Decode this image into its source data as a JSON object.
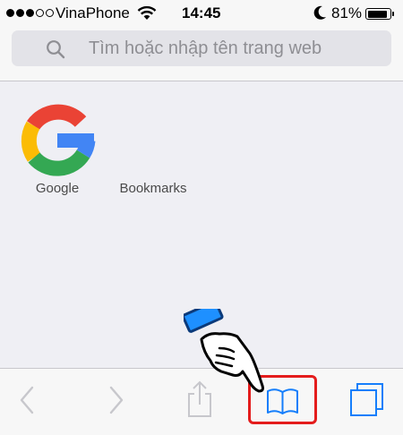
{
  "status_bar": {
    "carrier": "VinaPhone",
    "time": "14:45",
    "battery_percent": "81%",
    "signal_bars_filled": 3,
    "signal_bars_total": 5
  },
  "search": {
    "placeholder": "Tìm hoặc nhập tên trang web"
  },
  "favorites": [
    {
      "label": "Google",
      "icon": "google-logo"
    },
    {
      "label": "Bookmarks",
      "icon": "bookmarks-folder"
    }
  ],
  "toolbar": {
    "items": [
      "back-icon",
      "forward-icon",
      "share-icon",
      "bookmarks-icon",
      "tabs-icon"
    ],
    "highlighted": "bookmarks-icon"
  },
  "colors": {
    "accent": "#157efb",
    "highlight": "#e41c1c",
    "disabled": "#c7c7cc"
  }
}
